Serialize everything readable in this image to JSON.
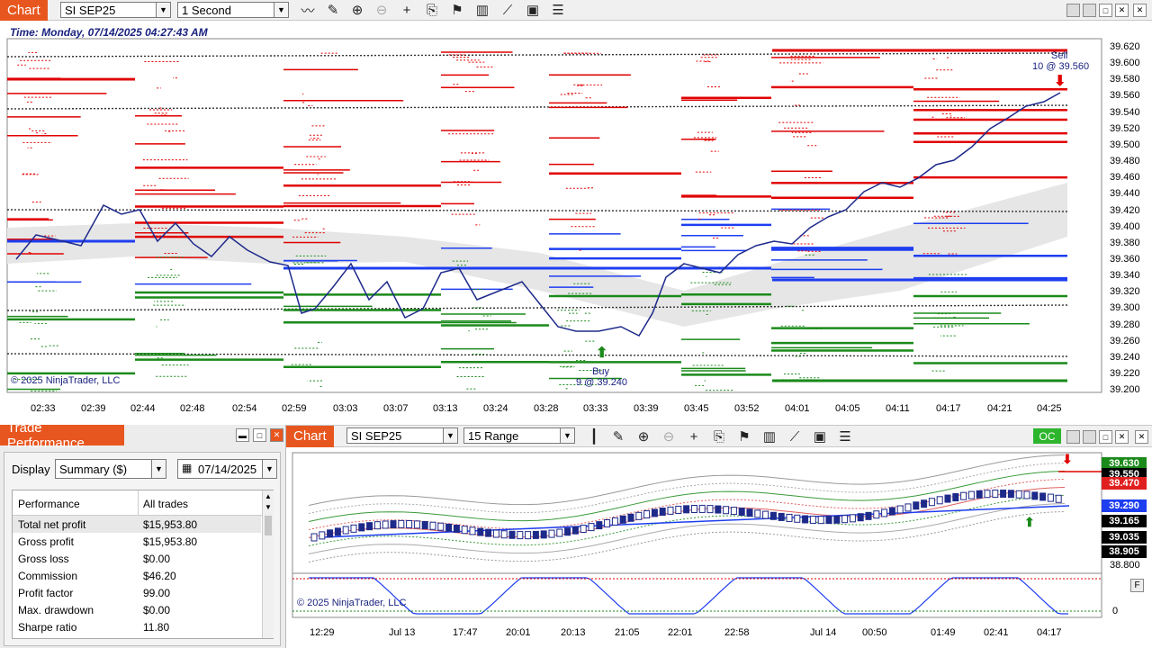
{
  "top_chart": {
    "tab_label": "Chart",
    "instrument": "SI SEP25",
    "interval": "1 Second",
    "time_header": "Time: Monday, 07/14/2025 04:27:43 AM",
    "copyright": "© 2025 NinjaTrader, LLC",
    "price_axis": [
      "39.620",
      "39.600",
      "39.580",
      "39.560",
      "39.540",
      "39.520",
      "39.500",
      "39.480",
      "39.460",
      "39.440",
      "39.420",
      "39.400",
      "39.380",
      "39.360",
      "39.340",
      "39.320",
      "39.300",
      "39.280",
      "39.260",
      "39.240",
      "39.220",
      "39.200"
    ],
    "time_axis": [
      "02:33",
      "02:39",
      "02:44",
      "02:48",
      "02:54",
      "02:59",
      "03:03",
      "03:07",
      "03:13",
      "03:24",
      "03:28",
      "03:33",
      "03:39",
      "03:45",
      "03:52",
      "04:01",
      "04:05",
      "04:11",
      "04:17",
      "04:21",
      "04:25"
    ],
    "sell_marker": {
      "label": "Sell",
      "detail": "10 @ 39.560"
    },
    "buy_marker": {
      "label": "Buy",
      "detail": "9 @ 39.240"
    },
    "icons": [
      "line-icon",
      "pencil-icon",
      "zoom-in-icon",
      "zoom-out-icon",
      "crosshair-icon",
      "properties-icon",
      "strategy-icon",
      "indicator-icon",
      "drawing-tool-icon",
      "data-box-icon",
      "list-icon"
    ]
  },
  "trade_performance": {
    "title": "Trade Performance",
    "display_label": "Display",
    "display_value": "Summary ($)",
    "date_value": "07/14/2025",
    "columns": [
      "Performance",
      "All trades"
    ],
    "rows": [
      {
        "label": "Total net profit",
        "value": "$15,953.80"
      },
      {
        "label": "Gross profit",
        "value": "$15,953.80"
      },
      {
        "label": "Gross loss",
        "value": "$0.00"
      },
      {
        "label": "Commission",
        "value": "$46.20"
      },
      {
        "label": "Profit factor",
        "value": "99.00"
      },
      {
        "label": "Max. drawdown",
        "value": "$0.00"
      },
      {
        "label": "Sharpe ratio",
        "value": "11.80"
      }
    ]
  },
  "bottom_chart": {
    "tab_label": "Chart",
    "instrument": "SI SEP25",
    "interval": "15 Range",
    "oc_label": "OC",
    "copyright": "© 2025 NinjaTrader, LLC",
    "price_tags": [
      {
        "value": "39.630",
        "color": "#1a8a1a"
      },
      {
        "value": "39.550",
        "color": "#000000"
      },
      {
        "value": "39.470",
        "color": "#e02020"
      },
      {
        "value": "39.290",
        "color": "#1e3ef0"
      },
      {
        "value": "39.165",
        "color": "#000000"
      },
      {
        "value": "39.035",
        "color": "#000000"
      },
      {
        "value": "38.905",
        "color": "#000000"
      }
    ],
    "axis_low": "38.800",
    "osc_zero": "0",
    "time_axis": [
      "12:29",
      "Jul 13",
      "17:47",
      "20:01",
      "20:13",
      "21:05",
      "22:01",
      "22:58",
      "Jul 14",
      "00:50",
      "01:49",
      "02:41",
      "04:17"
    ]
  },
  "colors": {
    "accent": "#e8561f",
    "sell": "#e00000",
    "buy": "#1a8a1a",
    "price_line": "#1e2a8a"
  }
}
